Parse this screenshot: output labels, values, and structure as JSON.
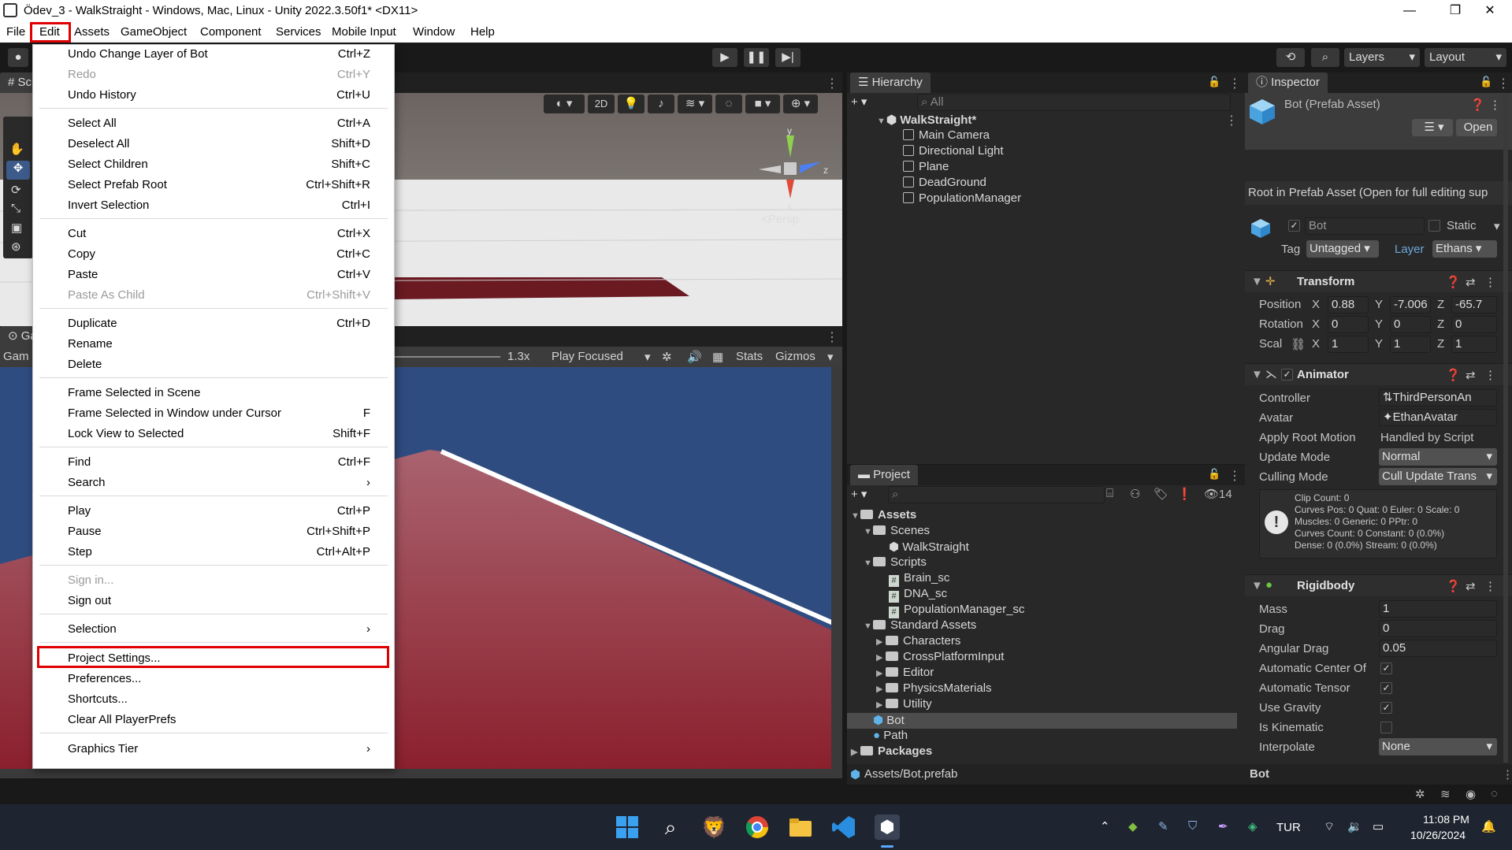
{
  "window": {
    "title": "Ödev_3 - WalkStraight - Windows, Mac, Linux - Unity 2022.3.50f1* <DX11>",
    "minimize": "—",
    "restore": "❐",
    "close": "✕"
  },
  "menubar": [
    "File",
    "Edit",
    "Assets",
    "GameObject",
    "Component",
    "Services",
    "Mobile Input",
    "Window",
    "Help"
  ],
  "toolbar": {
    "layers": "Layers",
    "layout": "Layout"
  },
  "edit_menu": [
    {
      "label": "Undo Change Layer of Bot",
      "shortcut": "Ctrl+Z",
      "disabled": false
    },
    {
      "label": "Redo",
      "shortcut": "Ctrl+Y",
      "disabled": true
    },
    {
      "label": "Undo History",
      "shortcut": "Ctrl+U",
      "disabled": false
    },
    {
      "label": "Select All",
      "shortcut": "Ctrl+A",
      "disabled": false
    },
    {
      "label": "Deselect All",
      "shortcut": "Shift+D",
      "disabled": false
    },
    {
      "label": "Select Children",
      "shortcut": "Shift+C",
      "disabled": false
    },
    {
      "label": "Select Prefab Root",
      "shortcut": "Ctrl+Shift+R",
      "disabled": false
    },
    {
      "label": "Invert Selection",
      "shortcut": "Ctrl+I",
      "disabled": false
    },
    {
      "label": "Cut",
      "shortcut": "Ctrl+X",
      "disabled": false
    },
    {
      "label": "Copy",
      "shortcut": "Ctrl+C",
      "disabled": false
    },
    {
      "label": "Paste",
      "shortcut": "Ctrl+V",
      "disabled": false
    },
    {
      "label": "Paste As Child",
      "shortcut": "Ctrl+Shift+V",
      "disabled": true
    },
    {
      "label": "Duplicate",
      "shortcut": "Ctrl+D",
      "disabled": false
    },
    {
      "label": "Rename",
      "shortcut": "",
      "disabled": false
    },
    {
      "label": "Delete",
      "shortcut": "",
      "disabled": false
    },
    {
      "label": "Frame Selected in Scene",
      "shortcut": "",
      "disabled": false
    },
    {
      "label": "Frame Selected in Window under Cursor",
      "shortcut": "F",
      "disabled": false
    },
    {
      "label": "Lock View to Selected",
      "shortcut": "Shift+F",
      "disabled": false
    },
    {
      "label": "Find",
      "shortcut": "Ctrl+F",
      "disabled": false
    },
    {
      "label": "Search",
      "shortcut": "›",
      "disabled": false
    },
    {
      "label": "Play",
      "shortcut": "Ctrl+P",
      "disabled": false
    },
    {
      "label": "Pause",
      "shortcut": "Ctrl+Shift+P",
      "disabled": false
    },
    {
      "label": "Step",
      "shortcut": "Ctrl+Alt+P",
      "disabled": false
    },
    {
      "label": "Sign in...",
      "shortcut": "",
      "disabled": true
    },
    {
      "label": "Sign out",
      "shortcut": "",
      "disabled": false
    },
    {
      "label": "Selection",
      "shortcut": "›",
      "disabled": false
    },
    {
      "label": "Project Settings...",
      "shortcut": "",
      "disabled": false
    },
    {
      "label": "Preferences...",
      "shortcut": "",
      "disabled": false
    },
    {
      "label": "Shortcuts...",
      "shortcut": "",
      "disabled": false
    },
    {
      "label": "Clear All PlayerPrefs",
      "shortcut": "",
      "disabled": false
    },
    {
      "label": "Graphics Tier",
      "shortcut": "›",
      "disabled": false
    }
  ],
  "scene_view": {
    "tab_label": "Sc",
    "btn_2d": "2D",
    "persp_label": "<Persp",
    "axis_y": "y",
    "axis_x": "x",
    "axis_z": "z"
  },
  "game_view": {
    "tab_label": "Ga",
    "display_label": "Gam",
    "scale": "1.3x",
    "play_mode": "Play Focused",
    "stats": "Stats",
    "gizmos": "Gizmos"
  },
  "hierarchy": {
    "tab": "Hierarchy",
    "search_placeholder": "All",
    "scene": "WalkStraight*",
    "items": [
      "Main Camera",
      "Directional Light",
      "Plane",
      "DeadGround",
      "PopulationManager"
    ]
  },
  "project": {
    "tab": "Project",
    "hidden_count": "14",
    "assets_root": "Assets",
    "scenes_folder": "Scenes",
    "scene_file": "WalkStraight",
    "scripts_folder": "Scripts",
    "scripts": [
      "Brain_sc",
      "DNA_sc",
      "PopulationManager_sc"
    ],
    "standard_assets": "Standard Assets",
    "standard_subfolders": [
      "Characters",
      "CrossPlatformInput",
      "Editor",
      "PhysicsMaterials",
      "Utility"
    ],
    "bot": "Bot",
    "path": "Path",
    "packages": "Packages",
    "footer_path": "Assets/Bot.prefab"
  },
  "inspector": {
    "tab": "Inspector",
    "title": "Bot (Prefab Asset)",
    "open_btn": "Open",
    "root_note": "Root in Prefab Asset (Open for full editing sup",
    "name": "Bot",
    "static": "Static",
    "tag_label": "Tag",
    "tag": "Untagged",
    "layer_label": "Layer",
    "layer": "Ethans",
    "transform": {
      "title": "Transform",
      "position_label": "Position",
      "rotation_label": "Rotation",
      "scale_label": "Scal",
      "pos": [
        "0.88",
        "-7.006",
        "-65.7"
      ],
      "rot": [
        "0",
        "0",
        "0"
      ],
      "scl": [
        "1",
        "1",
        "1"
      ],
      "x": "X",
      "y": "Y",
      "z": "Z"
    },
    "animator": {
      "title": "Animator",
      "controller_label": "Controller",
      "controller": "ThirdPersonAn",
      "avatar_label": "Avatar",
      "avatar": "EthanAvatar",
      "apply_root_label": "Apply Root Motion",
      "apply_root": "Handled by Script",
      "update_mode_label": "Update Mode",
      "update_mode": "Normal",
      "culling_label": "Culling Mode",
      "culling": "Cull Update Trans",
      "info": [
        "Clip Count: 0",
        "Curves Pos: 0 Quat: 0 Euler: 0 Scale: 0",
        "Muscles: 0 Generic: 0 PPtr: 0",
        "Curves Count: 0 Constant: 0 (0.0%)",
        "Dense: 0 (0.0%) Stream: 0 (0.0%)"
      ]
    },
    "rigidbody": {
      "title": "Rigidbody",
      "mass_label": "Mass",
      "mass": "1",
      "drag_label": "Drag",
      "drag": "0",
      "angular_label": "Angular Drag",
      "angular": "0.05",
      "auto_center_label": "Automatic Center Of",
      "auto_tensor_label": "Automatic Tensor",
      "gravity_label": "Use Gravity",
      "kinematic_label": "Is Kinematic",
      "interpolate_label": "Interpolate",
      "interpolate": "None"
    },
    "footer": "Bot"
  },
  "taskbar": {
    "lang": "TUR",
    "time": "11:08 PM",
    "date": "10/26/2024"
  }
}
